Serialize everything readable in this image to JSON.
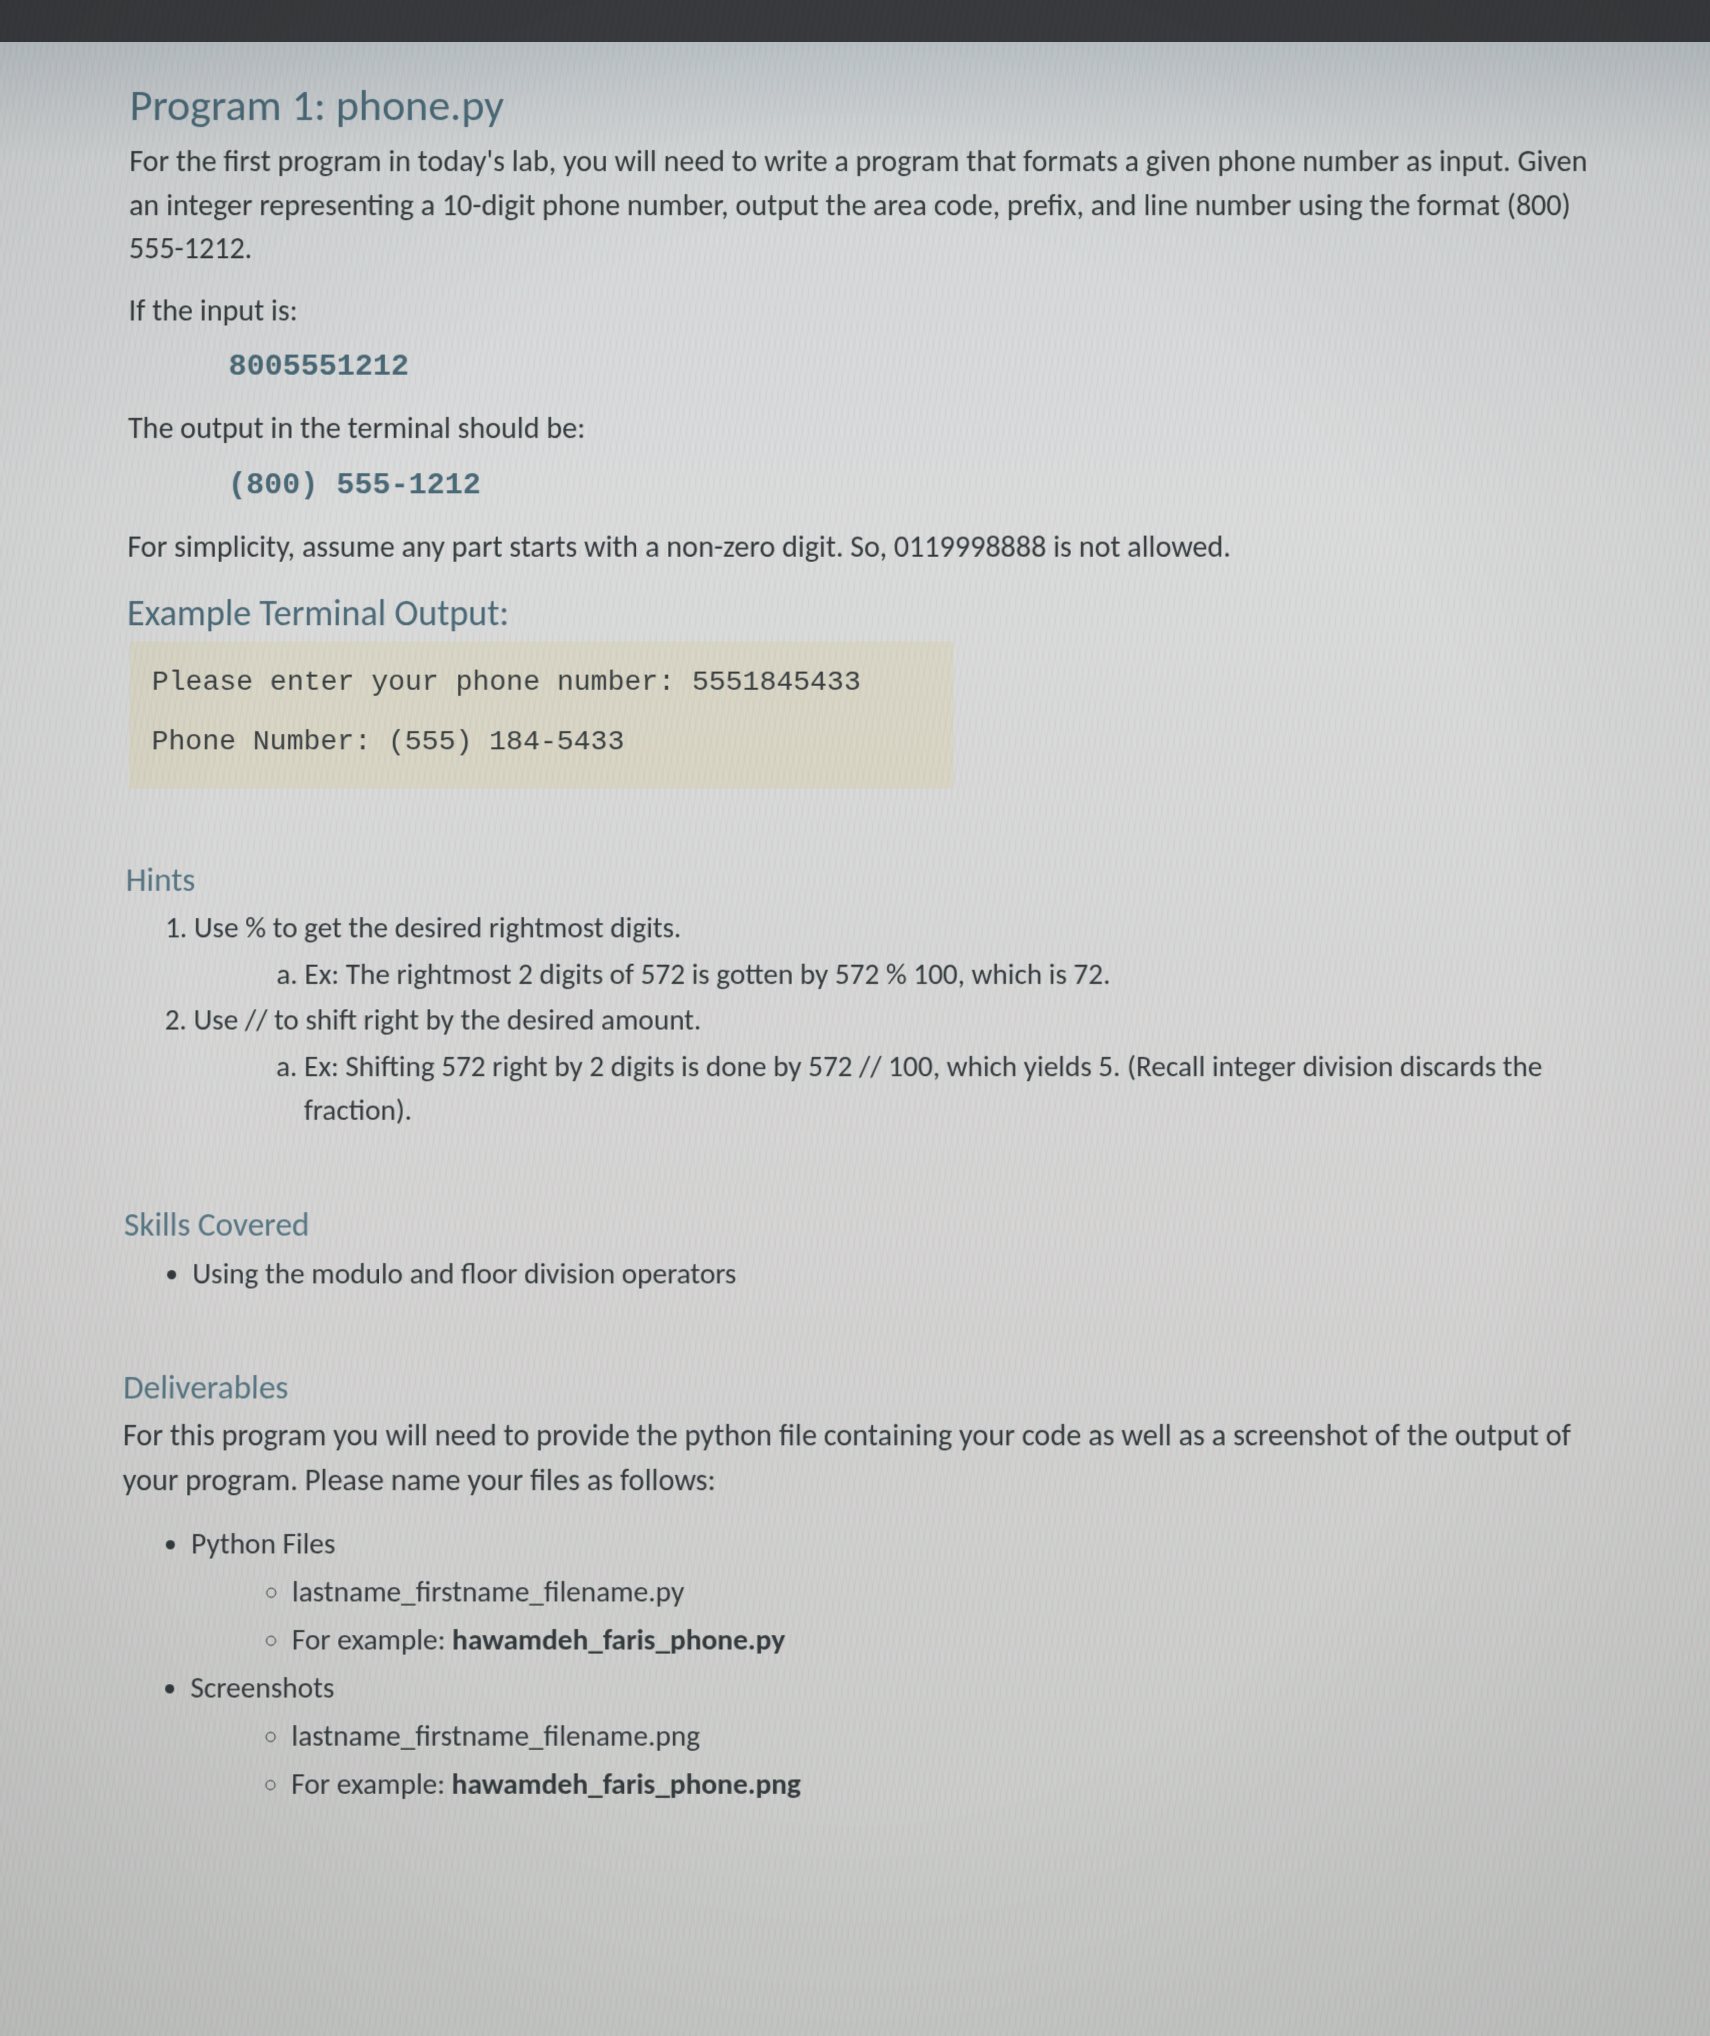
{
  "title": "Program 1: phone.py",
  "intro": "For the first program in today's lab, you will need to write a program that formats a given phone number as input. Given an integer representing a 10-digit phone number, output the area code, prefix, and line number using the format (800) 555-1212.",
  "if_input_label": "If the input is:",
  "example_input": "8005551212",
  "output_label": "The output in the terminal should be:",
  "example_output": "(800) 555-1212",
  "simplicity_note": "For simplicity, assume any part starts with a non-zero digit. So, 0119998888 is not allowed.",
  "example_terminal_heading": "Example Terminal Output:",
  "terminal": {
    "line1": "Please enter your phone number: 5551845433",
    "line2": "Phone Number: (555) 184-5433"
  },
  "hints_heading": "Hints",
  "hints": {
    "h1": "Use % to get the desired rightmost digits.",
    "h1a": "Ex: The rightmost 2 digits of 572 is gotten by 572 % 100, which is 72.",
    "h2": "Use // to shift right by the desired amount.",
    "h2a": "Ex: Shifting 572 right by 2 digits is done by 572 // 100, which yields 5. (Recall integer division discards the fraction)."
  },
  "skills_heading": "Skills Covered",
  "skills": {
    "s1": "Using the modulo and floor division operators"
  },
  "deliverables_heading": "Deliverables",
  "deliverables_intro": "For this program you will need to provide the python file containing your code as well as a screenshot of the output of your program. Please name your files as follows:",
  "deliverables": {
    "python_label": "Python Files",
    "python_name": "lastname_firstname_filename.py",
    "python_example_prefix": "For example: ",
    "python_example_bold": "hawamdeh_faris_phone.py",
    "screenshots_label": "Screenshots",
    "screenshot_name": "lastname_firstname_filename.png",
    "screenshot_example_prefix": "For example: ",
    "screenshot_example_bold": "hawamdeh_faris_phone.png"
  }
}
